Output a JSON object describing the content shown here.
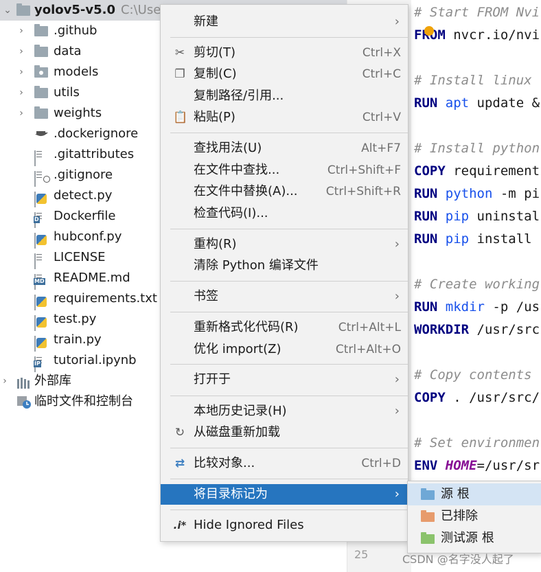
{
  "tree": {
    "root": {
      "name": "yolov5-v5.0",
      "path": "C:\\Users"
    },
    "items": [
      {
        "label": ".github",
        "kind": "folder",
        "expandable": true
      },
      {
        "label": "data",
        "kind": "folder",
        "expandable": true
      },
      {
        "label": "models",
        "kind": "folder",
        "expandable": true
      },
      {
        "label": "utils",
        "kind": "folder",
        "expandable": true
      },
      {
        "label": "weights",
        "kind": "folder",
        "expandable": true
      },
      {
        "label": ".dockerignore",
        "kind": "docker-file"
      },
      {
        "label": ".gitattributes",
        "kind": "text-file"
      },
      {
        "label": ".gitignore",
        "kind": "ignore-file"
      },
      {
        "label": "detect.py",
        "kind": "python-file"
      },
      {
        "label": "Dockerfile",
        "kind": "dockerfile"
      },
      {
        "label": "hubconf.py",
        "kind": "python-file"
      },
      {
        "label": "LICENSE",
        "kind": "text-file"
      },
      {
        "label": "README.md",
        "kind": "markdown-file"
      },
      {
        "label": "requirements.txt",
        "kind": "requirements-file"
      },
      {
        "label": "test.py",
        "kind": "python-file"
      },
      {
        "label": "train.py",
        "kind": "python-file"
      },
      {
        "label": "tutorial.ipynb",
        "kind": "notebook-file"
      }
    ],
    "external_libs": "外部库",
    "scratches": "临时文件和控制台"
  },
  "editor": {
    "lines": [
      {
        "segments": [
          {
            "t": "# Start FROM Nvi",
            "c": "cm"
          }
        ]
      },
      {
        "segments": [
          {
            "t": "FROM",
            "c": "kw"
          },
          {
            "t": " nvcr.io/nvi",
            "c": ""
          }
        ]
      },
      {
        "segments": [
          {
            "t": "# Install linux",
            "c": "cm"
          }
        ]
      },
      {
        "segments": [
          {
            "t": "RUN",
            "c": "kw"
          },
          {
            "t": " ",
            "c": ""
          },
          {
            "t": "apt",
            "c": "fn"
          },
          {
            "t": " update &",
            "c": ""
          }
        ]
      },
      {
        "segments": [
          {
            "t": "# Install python",
            "c": "cm"
          }
        ]
      },
      {
        "segments": [
          {
            "t": "COPY",
            "c": "kw"
          },
          {
            "t": " requirement",
            "c": ""
          }
        ]
      },
      {
        "segments": [
          {
            "t": "RUN",
            "c": "kw"
          },
          {
            "t": " ",
            "c": ""
          },
          {
            "t": "python",
            "c": "fn"
          },
          {
            "t": " -m pi",
            "c": ""
          }
        ]
      },
      {
        "segments": [
          {
            "t": "RUN",
            "c": "kw"
          },
          {
            "t": " ",
            "c": ""
          },
          {
            "t": "pip",
            "c": "fn"
          },
          {
            "t": " uninstal",
            "c": ""
          }
        ]
      },
      {
        "segments": [
          {
            "t": "RUN",
            "c": "kw"
          },
          {
            "t": " ",
            "c": ""
          },
          {
            "t": "pip",
            "c": "fn"
          },
          {
            "t": " install ",
            "c": ""
          }
        ]
      },
      {
        "segments": [
          {
            "t": "# Create working",
            "c": "cm"
          }
        ]
      },
      {
        "segments": [
          {
            "t": "RUN",
            "c": "kw"
          },
          {
            "t": " ",
            "c": ""
          },
          {
            "t": "mkdir",
            "c": "fn"
          },
          {
            "t": " -p /us",
            "c": ""
          }
        ]
      },
      {
        "segments": [
          {
            "t": "WORKDIR",
            "c": "kw"
          },
          {
            "t": " /usr/src",
            "c": ""
          }
        ]
      },
      {
        "segments": [
          {
            "t": "# Copy contents",
            "c": "cm"
          }
        ]
      },
      {
        "segments": [
          {
            "t": "COPY",
            "c": "kw"
          },
          {
            "t": " . /usr/src/",
            "c": ""
          }
        ]
      },
      {
        "segments": [
          {
            "t": "# Set environmen",
            "c": "cm"
          }
        ]
      },
      {
        "segments": [
          {
            "t": "ENV",
            "c": "kw"
          },
          {
            "t": " ",
            "c": ""
          },
          {
            "t": "HOME",
            "c": "var"
          },
          {
            "t": "=/usr/sr",
            "c": ""
          }
        ]
      }
    ],
    "line_number": "25"
  },
  "menu": {
    "items": [
      {
        "label": "新建",
        "submenu": true
      },
      {
        "label": "剪切(T)",
        "shortcut": "Ctrl+X",
        "icon": "scissors-icon"
      },
      {
        "label": "复制(C)",
        "shortcut": "Ctrl+C",
        "icon": "copy-icon"
      },
      {
        "label": "复制路径/引用..."
      },
      {
        "label": "粘贴(P)",
        "shortcut": "Ctrl+V",
        "icon": "clipboard-icon"
      },
      {
        "label": "查找用法(U)",
        "shortcut": "Alt+F7"
      },
      {
        "label": "在文件中查找...",
        "shortcut": "Ctrl+Shift+F"
      },
      {
        "label": "在文件中替换(A)...",
        "shortcut": "Ctrl+Shift+R"
      },
      {
        "label": "检查代码(I)..."
      },
      {
        "label": "重构(R)",
        "submenu": true
      },
      {
        "label": "清除 Python 编译文件"
      },
      {
        "label": "书签",
        "submenu": true
      },
      {
        "label": "重新格式化代码(R)",
        "shortcut": "Ctrl+Alt+L"
      },
      {
        "label": "优化 import(Z)",
        "shortcut": "Ctrl+Alt+O"
      },
      {
        "label": "打开于",
        "submenu": true
      },
      {
        "label": "本地历史记录(H)",
        "submenu": true
      },
      {
        "label": "从磁盘重新加载",
        "icon": "reload-icon"
      },
      {
        "label": "比较对象...",
        "shortcut": "Ctrl+D",
        "icon": "compare-icon"
      },
      {
        "label": "将目录标记为",
        "submenu": true,
        "active": true
      },
      {
        "label": "Hide Ignored Files",
        "icon": "ignored-files-icon"
      }
    ],
    "submenu_arrow": "›"
  },
  "submenu": {
    "items": [
      {
        "label": "源 根",
        "color": "#6fa8d6"
      },
      {
        "label": "已排除",
        "color": "#e79b6c"
      },
      {
        "label": "测试源 根",
        "color": "#8bc36c"
      }
    ]
  },
  "watermark": "CSDN @名字没人起了",
  "colors": {
    "menu_active": "#2675bf",
    "selection": "#d7d9dd"
  }
}
